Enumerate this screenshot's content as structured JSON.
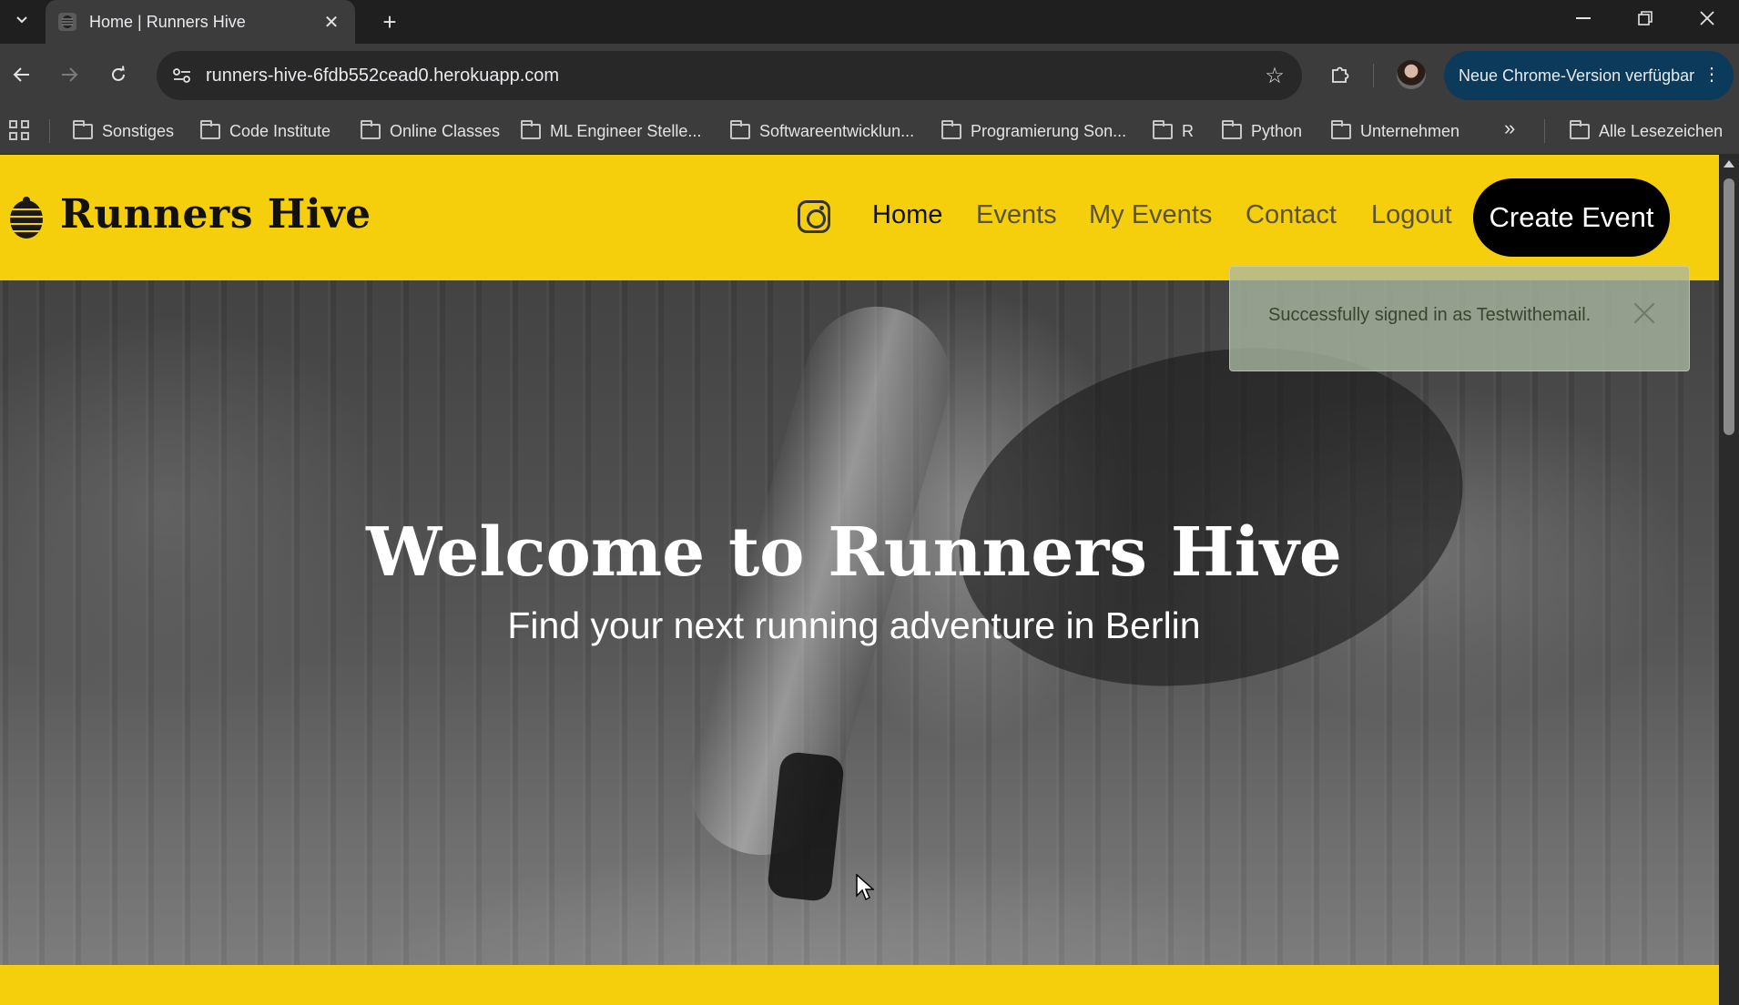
{
  "browser": {
    "tab": {
      "title": "Home | Runners Hive"
    },
    "address_bar": {
      "url": "runners-hive-6fdb552cead0.herokuapp.com"
    },
    "update_button": {
      "label": "Neue Chrome-Version verfügbar"
    },
    "bookmarks": [
      {
        "label": "Sonstiges"
      },
      {
        "label": "Code Institute"
      },
      {
        "label": "Online Classes"
      },
      {
        "label": "ML Engineer Stelle..."
      },
      {
        "label": "Softwareentwicklun..."
      },
      {
        "label": "Programierung Son..."
      },
      {
        "label": "R"
      },
      {
        "label": "Python"
      },
      {
        "label": "Unternehmen"
      }
    ],
    "all_bookmarks": {
      "label": "Alle Lesezeichen"
    }
  },
  "site": {
    "brand": "Runners Hive",
    "nav": {
      "home": "Home",
      "events": "Events",
      "my_events": "My Events",
      "contact": "Contact",
      "logout": "Logout",
      "create_event": "Create Event"
    },
    "hero": {
      "title": "Welcome to Runners Hive",
      "subtitle": "Find your next running adventure in Berlin"
    },
    "alert": {
      "message": "Successfully signed in as Testwithemail."
    }
  },
  "colors": {
    "brand_yellow": "#f5cf0b",
    "cta_black": "#000000",
    "alert_green": "#aab8a2"
  }
}
